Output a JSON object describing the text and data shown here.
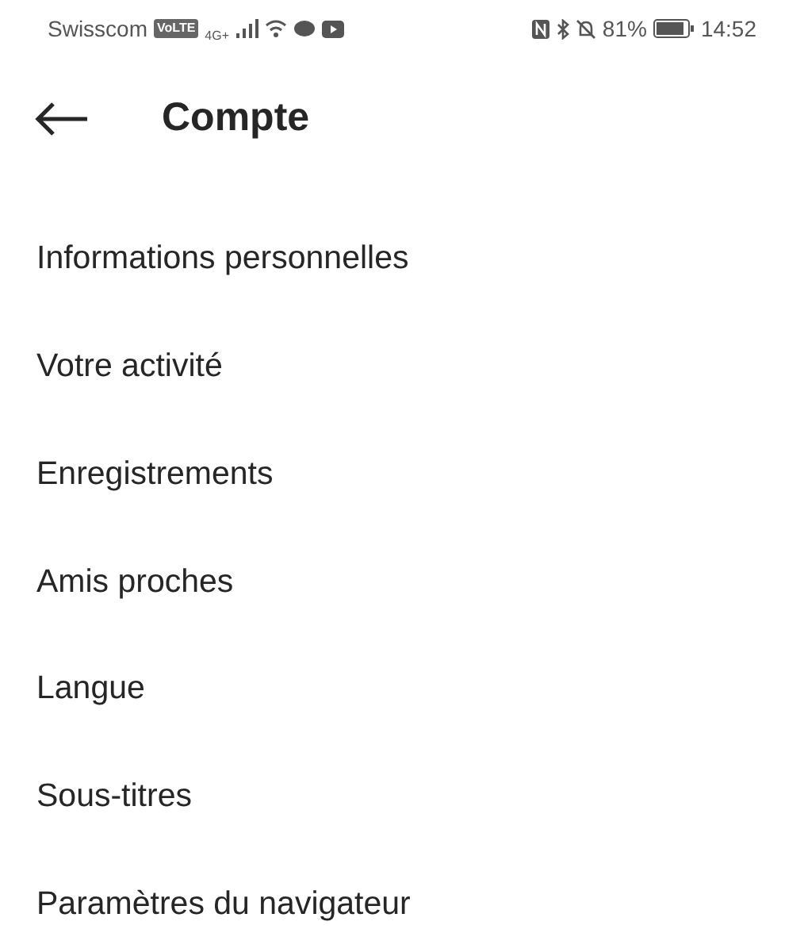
{
  "status_bar": {
    "carrier": "Swisscom",
    "volte": "VoLTE",
    "network": "4G+",
    "battery": "81%",
    "time": "14:52"
  },
  "header": {
    "title": "Compte"
  },
  "items": [
    {
      "label": "Informations personnelles"
    },
    {
      "label": "Votre activité"
    },
    {
      "label": "Enregistrements"
    },
    {
      "label": "Amis proches"
    },
    {
      "label": "Langue"
    },
    {
      "label": "Sous-titres"
    },
    {
      "label": "Paramètres du navigateur"
    }
  ]
}
